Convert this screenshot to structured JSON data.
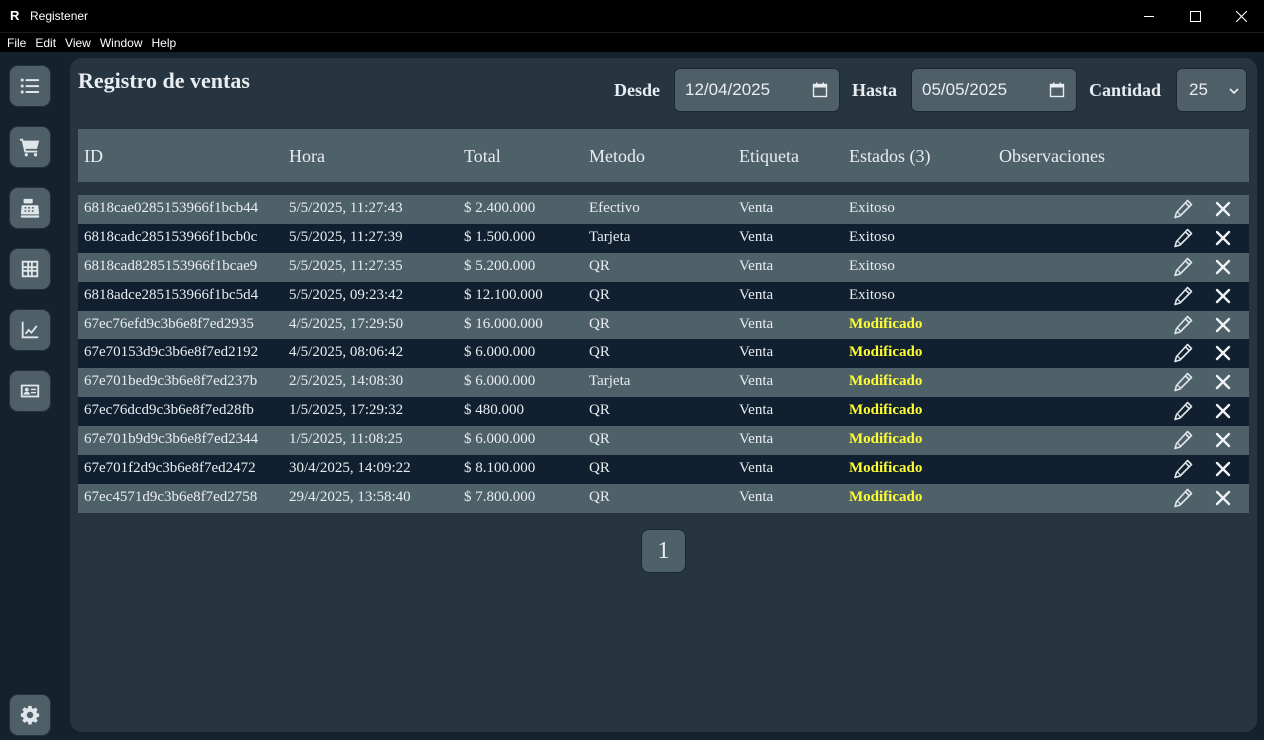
{
  "window": {
    "title": "Registener",
    "logo_letter": "R"
  },
  "menu": [
    "File",
    "Edit",
    "View",
    "Window",
    "Help"
  ],
  "sidebar": {
    "items": [
      {
        "icon": "list-icon"
      },
      {
        "icon": "cart-icon"
      },
      {
        "icon": "cash-register-icon"
      },
      {
        "icon": "table-grid-icon"
      },
      {
        "icon": "chart-line-icon"
      },
      {
        "icon": "id-card-icon"
      }
    ],
    "settings_icon": "gear-icon"
  },
  "page": {
    "title": "Registro de ventas",
    "filters": {
      "desde_label": "Desde",
      "desde_value": "12/04/2025",
      "hasta_label": "Hasta",
      "hasta_value": "05/05/2025",
      "cantidad_label": "Cantidad",
      "cantidad_value": "25"
    }
  },
  "table": {
    "columns": [
      "ID",
      "Hora",
      "Total",
      "Metodo",
      "Etiqueta",
      "Estados (3)",
      "Observaciones"
    ],
    "rows": [
      {
        "id": "6818cae0285153966f1bcb44",
        "hora": "5/5/2025, 11:27:43",
        "total": "$ 2.400.000",
        "metodo": "Efectivo",
        "etiqueta": "Venta",
        "estado": "Exitoso",
        "observaciones": ""
      },
      {
        "id": "6818cadc285153966f1bcb0c",
        "hora": "5/5/2025, 11:27:39",
        "total": "$ 1.500.000",
        "metodo": "Tarjeta",
        "etiqueta": "Venta",
        "estado": "Exitoso",
        "observaciones": ""
      },
      {
        "id": "6818cad8285153966f1bcae9",
        "hora": "5/5/2025, 11:27:35",
        "total": "$ 5.200.000",
        "metodo": "QR",
        "etiqueta": "Venta",
        "estado": "Exitoso",
        "observaciones": ""
      },
      {
        "id": "6818adce285153966f1bc5d4",
        "hora": "5/5/2025, 09:23:42",
        "total": "$ 12.100.000",
        "metodo": "QR",
        "etiqueta": "Venta",
        "estado": "Exitoso",
        "observaciones": ""
      },
      {
        "id": "67ec76efd9c3b6e8f7ed2935",
        "hora": "4/5/2025, 17:29:50",
        "total": "$ 16.000.000",
        "metodo": "QR",
        "etiqueta": "Venta",
        "estado": "Modificado",
        "observaciones": ""
      },
      {
        "id": "67e70153d9c3b6e8f7ed2192",
        "hora": "4/5/2025, 08:06:42",
        "total": "$ 6.000.000",
        "metodo": "QR",
        "etiqueta": "Venta",
        "estado": "Modificado",
        "observaciones": ""
      },
      {
        "id": "67e701bed9c3b6e8f7ed237b",
        "hora": "2/5/2025, 14:08:30",
        "total": "$ 6.000.000",
        "metodo": "Tarjeta",
        "etiqueta": "Venta",
        "estado": "Modificado",
        "observaciones": ""
      },
      {
        "id": "67ec76dcd9c3b6e8f7ed28fb",
        "hora": "1/5/2025, 17:29:32",
        "total": "$ 480.000",
        "metodo": "QR",
        "etiqueta": "Venta",
        "estado": "Modificado",
        "observaciones": ""
      },
      {
        "id": "67e701b9d9c3b6e8f7ed2344",
        "hora": "1/5/2025, 11:08:25",
        "total": "$ 6.000.000",
        "metodo": "QR",
        "etiqueta": "Venta",
        "estado": "Modificado",
        "observaciones": ""
      },
      {
        "id": "67e701f2d9c3b6e8f7ed2472",
        "hora": "30/4/2025, 14:09:22",
        "total": "$ 8.100.000",
        "metodo": "QR",
        "etiqueta": "Venta",
        "estado": "Modificado",
        "observaciones": ""
      },
      {
        "id": "67ec4571d9c3b6e8f7ed2758",
        "hora": "29/4/2025, 13:58:40",
        "total": "$ 7.800.000",
        "metodo": "QR",
        "etiqueta": "Venta",
        "estado": "Modificado",
        "observaciones": ""
      }
    ]
  },
  "pagination": {
    "current_page": "1"
  },
  "colors": {
    "modified_status": "#ffff30",
    "row_light": "#4f6168",
    "row_dark": "#102030",
    "panel": "#26353f"
  }
}
